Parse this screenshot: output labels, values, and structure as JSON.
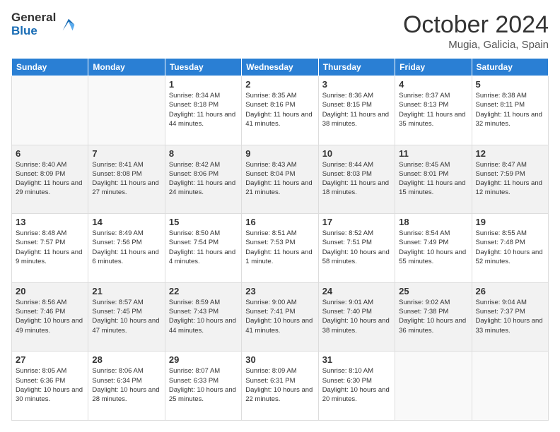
{
  "header": {
    "logo_general": "General",
    "logo_blue": "Blue",
    "month_title": "October 2024",
    "location": "Mugia, Galicia, Spain"
  },
  "days_of_week": [
    "Sunday",
    "Monday",
    "Tuesday",
    "Wednesday",
    "Thursday",
    "Friday",
    "Saturday"
  ],
  "weeks": [
    [
      {
        "day": "",
        "info": ""
      },
      {
        "day": "",
        "info": ""
      },
      {
        "day": "1",
        "info": "Sunrise: 8:34 AM\nSunset: 8:18 PM\nDaylight: 11 hours and 44 minutes."
      },
      {
        "day": "2",
        "info": "Sunrise: 8:35 AM\nSunset: 8:16 PM\nDaylight: 11 hours and 41 minutes."
      },
      {
        "day": "3",
        "info": "Sunrise: 8:36 AM\nSunset: 8:15 PM\nDaylight: 11 hours and 38 minutes."
      },
      {
        "day": "4",
        "info": "Sunrise: 8:37 AM\nSunset: 8:13 PM\nDaylight: 11 hours and 35 minutes."
      },
      {
        "day": "5",
        "info": "Sunrise: 8:38 AM\nSunset: 8:11 PM\nDaylight: 11 hours and 32 minutes."
      }
    ],
    [
      {
        "day": "6",
        "info": "Sunrise: 8:40 AM\nSunset: 8:09 PM\nDaylight: 11 hours and 29 minutes."
      },
      {
        "day": "7",
        "info": "Sunrise: 8:41 AM\nSunset: 8:08 PM\nDaylight: 11 hours and 27 minutes."
      },
      {
        "day": "8",
        "info": "Sunrise: 8:42 AM\nSunset: 8:06 PM\nDaylight: 11 hours and 24 minutes."
      },
      {
        "day": "9",
        "info": "Sunrise: 8:43 AM\nSunset: 8:04 PM\nDaylight: 11 hours and 21 minutes."
      },
      {
        "day": "10",
        "info": "Sunrise: 8:44 AM\nSunset: 8:03 PM\nDaylight: 11 hours and 18 minutes."
      },
      {
        "day": "11",
        "info": "Sunrise: 8:45 AM\nSunset: 8:01 PM\nDaylight: 11 hours and 15 minutes."
      },
      {
        "day": "12",
        "info": "Sunrise: 8:47 AM\nSunset: 7:59 PM\nDaylight: 11 hours and 12 minutes."
      }
    ],
    [
      {
        "day": "13",
        "info": "Sunrise: 8:48 AM\nSunset: 7:57 PM\nDaylight: 11 hours and 9 minutes."
      },
      {
        "day": "14",
        "info": "Sunrise: 8:49 AM\nSunset: 7:56 PM\nDaylight: 11 hours and 6 minutes."
      },
      {
        "day": "15",
        "info": "Sunrise: 8:50 AM\nSunset: 7:54 PM\nDaylight: 11 hours and 4 minutes."
      },
      {
        "day": "16",
        "info": "Sunrise: 8:51 AM\nSunset: 7:53 PM\nDaylight: 11 hours and 1 minute."
      },
      {
        "day": "17",
        "info": "Sunrise: 8:52 AM\nSunset: 7:51 PM\nDaylight: 10 hours and 58 minutes."
      },
      {
        "day": "18",
        "info": "Sunrise: 8:54 AM\nSunset: 7:49 PM\nDaylight: 10 hours and 55 minutes."
      },
      {
        "day": "19",
        "info": "Sunrise: 8:55 AM\nSunset: 7:48 PM\nDaylight: 10 hours and 52 minutes."
      }
    ],
    [
      {
        "day": "20",
        "info": "Sunrise: 8:56 AM\nSunset: 7:46 PM\nDaylight: 10 hours and 49 minutes."
      },
      {
        "day": "21",
        "info": "Sunrise: 8:57 AM\nSunset: 7:45 PM\nDaylight: 10 hours and 47 minutes."
      },
      {
        "day": "22",
        "info": "Sunrise: 8:59 AM\nSunset: 7:43 PM\nDaylight: 10 hours and 44 minutes."
      },
      {
        "day": "23",
        "info": "Sunrise: 9:00 AM\nSunset: 7:41 PM\nDaylight: 10 hours and 41 minutes."
      },
      {
        "day": "24",
        "info": "Sunrise: 9:01 AM\nSunset: 7:40 PM\nDaylight: 10 hours and 38 minutes."
      },
      {
        "day": "25",
        "info": "Sunrise: 9:02 AM\nSunset: 7:38 PM\nDaylight: 10 hours and 36 minutes."
      },
      {
        "day": "26",
        "info": "Sunrise: 9:04 AM\nSunset: 7:37 PM\nDaylight: 10 hours and 33 minutes."
      }
    ],
    [
      {
        "day": "27",
        "info": "Sunrise: 8:05 AM\nSunset: 6:36 PM\nDaylight: 10 hours and 30 minutes."
      },
      {
        "day": "28",
        "info": "Sunrise: 8:06 AM\nSunset: 6:34 PM\nDaylight: 10 hours and 28 minutes."
      },
      {
        "day": "29",
        "info": "Sunrise: 8:07 AM\nSunset: 6:33 PM\nDaylight: 10 hours and 25 minutes."
      },
      {
        "day": "30",
        "info": "Sunrise: 8:09 AM\nSunset: 6:31 PM\nDaylight: 10 hours and 22 minutes."
      },
      {
        "day": "31",
        "info": "Sunrise: 8:10 AM\nSunset: 6:30 PM\nDaylight: 10 hours and 20 minutes."
      },
      {
        "day": "",
        "info": ""
      },
      {
        "day": "",
        "info": ""
      }
    ]
  ]
}
